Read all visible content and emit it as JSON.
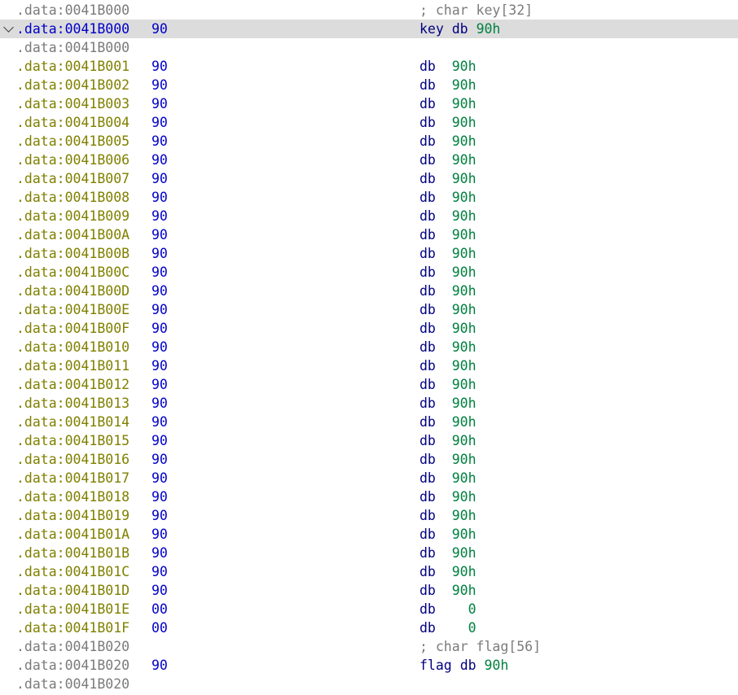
{
  "rows": [
    {
      "kind": "comment",
      "addr": ".data:0041B000",
      "bytes": "",
      "comment": "; char key[32]"
    },
    {
      "kind": "label",
      "addr": ".data:0041B000",
      "bytes": "90",
      "label": "key",
      "mnem": "db",
      "val": "90h",
      "current": true
    },
    {
      "kind": "blank",
      "addr": ".data:0041B000",
      "bytes": ""
    },
    {
      "kind": "db",
      "addr": ".data:0041B001",
      "bytes": "90",
      "mnem": "db",
      "val": "90h"
    },
    {
      "kind": "db",
      "addr": ".data:0041B002",
      "bytes": "90",
      "mnem": "db",
      "val": "90h"
    },
    {
      "kind": "db",
      "addr": ".data:0041B003",
      "bytes": "90",
      "mnem": "db",
      "val": "90h"
    },
    {
      "kind": "db",
      "addr": ".data:0041B004",
      "bytes": "90",
      "mnem": "db",
      "val": "90h"
    },
    {
      "kind": "db",
      "addr": ".data:0041B005",
      "bytes": "90",
      "mnem": "db",
      "val": "90h"
    },
    {
      "kind": "db",
      "addr": ".data:0041B006",
      "bytes": "90",
      "mnem": "db",
      "val": "90h"
    },
    {
      "kind": "db",
      "addr": ".data:0041B007",
      "bytes": "90",
      "mnem": "db",
      "val": "90h"
    },
    {
      "kind": "db",
      "addr": ".data:0041B008",
      "bytes": "90",
      "mnem": "db",
      "val": "90h"
    },
    {
      "kind": "db",
      "addr": ".data:0041B009",
      "bytes": "90",
      "mnem": "db",
      "val": "90h"
    },
    {
      "kind": "db",
      "addr": ".data:0041B00A",
      "bytes": "90",
      "mnem": "db",
      "val": "90h"
    },
    {
      "kind": "db",
      "addr": ".data:0041B00B",
      "bytes": "90",
      "mnem": "db",
      "val": "90h"
    },
    {
      "kind": "db",
      "addr": ".data:0041B00C",
      "bytes": "90",
      "mnem": "db",
      "val": "90h"
    },
    {
      "kind": "db",
      "addr": ".data:0041B00D",
      "bytes": "90",
      "mnem": "db",
      "val": "90h"
    },
    {
      "kind": "db",
      "addr": ".data:0041B00E",
      "bytes": "90",
      "mnem": "db",
      "val": "90h"
    },
    {
      "kind": "db",
      "addr": ".data:0041B00F",
      "bytes": "90",
      "mnem": "db",
      "val": "90h"
    },
    {
      "kind": "db",
      "addr": ".data:0041B010",
      "bytes": "90",
      "mnem": "db",
      "val": "90h"
    },
    {
      "kind": "db",
      "addr": ".data:0041B011",
      "bytes": "90",
      "mnem": "db",
      "val": "90h"
    },
    {
      "kind": "db",
      "addr": ".data:0041B012",
      "bytes": "90",
      "mnem": "db",
      "val": "90h"
    },
    {
      "kind": "db",
      "addr": ".data:0041B013",
      "bytes": "90",
      "mnem": "db",
      "val": "90h"
    },
    {
      "kind": "db",
      "addr": ".data:0041B014",
      "bytes": "90",
      "mnem": "db",
      "val": "90h"
    },
    {
      "kind": "db",
      "addr": ".data:0041B015",
      "bytes": "90",
      "mnem": "db",
      "val": "90h"
    },
    {
      "kind": "db",
      "addr": ".data:0041B016",
      "bytes": "90",
      "mnem": "db",
      "val": "90h"
    },
    {
      "kind": "db",
      "addr": ".data:0041B017",
      "bytes": "90",
      "mnem": "db",
      "val": "90h"
    },
    {
      "kind": "db",
      "addr": ".data:0041B018",
      "bytes": "90",
      "mnem": "db",
      "val": "90h"
    },
    {
      "kind": "db",
      "addr": ".data:0041B019",
      "bytes": "90",
      "mnem": "db",
      "val": "90h"
    },
    {
      "kind": "db",
      "addr": ".data:0041B01A",
      "bytes": "90",
      "mnem": "db",
      "val": "90h"
    },
    {
      "kind": "db",
      "addr": ".data:0041B01B",
      "bytes": "90",
      "mnem": "db",
      "val": "90h"
    },
    {
      "kind": "db",
      "addr": ".data:0041B01C",
      "bytes": "90",
      "mnem": "db",
      "val": "90h"
    },
    {
      "kind": "db",
      "addr": ".data:0041B01D",
      "bytes": "90",
      "mnem": "db",
      "val": "90h"
    },
    {
      "kind": "db",
      "addr": ".data:0041B01E",
      "bytes": "00",
      "mnem": "db",
      "val": "0"
    },
    {
      "kind": "db",
      "addr": ".data:0041B01F",
      "bytes": "00",
      "mnem": "db",
      "val": "0"
    },
    {
      "kind": "comment",
      "addr": ".data:0041B020",
      "bytes": "",
      "comment": "; char flag[56]"
    },
    {
      "kind": "label",
      "addr": ".data:0041B020",
      "bytes": "90",
      "label": "flag",
      "mnem": "db",
      "val": "90h"
    },
    {
      "kind": "blank",
      "addr": ".data:0041B020",
      "bytes": ""
    }
  ],
  "colors": {
    "address_gray": "#7b7b7b",
    "address_olive": "#808000",
    "address_current": "#0000c8",
    "bytes": "#0000c8",
    "mnemonic": "#000080",
    "value": "#008040",
    "comment": "#7b7b7b",
    "current_line_bg": "#dcdcdc"
  },
  "icons": {
    "collapse": "chevron-down-icon"
  }
}
